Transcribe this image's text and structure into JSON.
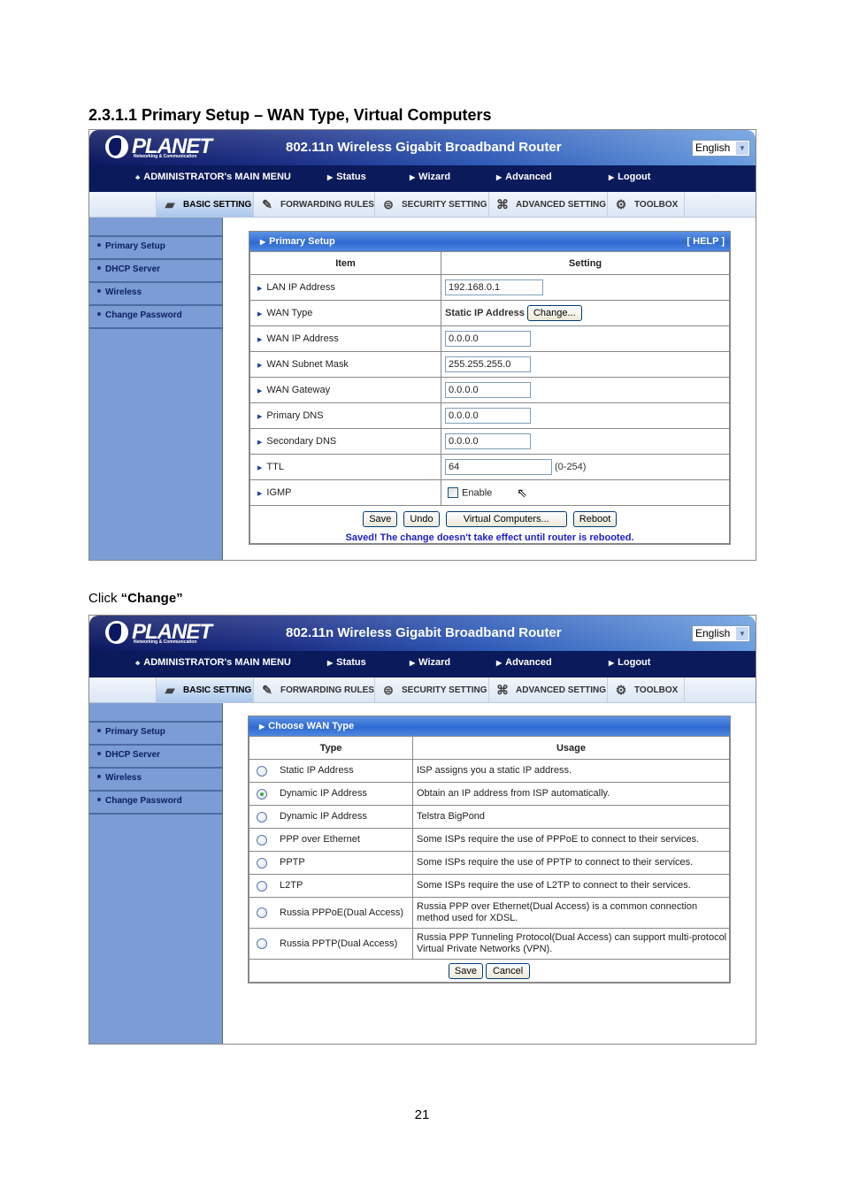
{
  "document": {
    "heading": "2.3.1.1 Primary Setup – WAN Type, Virtual Computers",
    "caption_prefix": "Click ",
    "caption_bold": "“Change”",
    "page_number": "21"
  },
  "router_ui": {
    "logo_text": "PLANET",
    "logo_subtext": "Networking & Communication",
    "product_title": "802.11n Wireless Gigabit Broadband Router",
    "language_selected": "English",
    "main_menu": {
      "admin": "ADMINISTRATOR's MAIN MENU",
      "status": "Status",
      "wizard": "Wizard",
      "advanced": "Advanced",
      "logout": "Logout"
    },
    "tabs": [
      {
        "label": "BASIC SETTING",
        "icon": "folder-icon",
        "active": true
      },
      {
        "label": "FORWARDING RULES",
        "icon": "forwarding-icon",
        "active": false
      },
      {
        "label": "SECURITY SETTING",
        "icon": "security-icon",
        "active": false
      },
      {
        "label": "ADVANCED SETTING",
        "icon": "advanced-icon",
        "active": false
      },
      {
        "label": "TOOLBOX",
        "icon": "toolbox-icon",
        "active": false
      }
    ],
    "sidebar": [
      {
        "label": "Primary Setup"
      },
      {
        "label": "DHCP Server"
      },
      {
        "label": "Wireless"
      },
      {
        "label": "Change Password"
      }
    ],
    "colors": {
      "banner_dark": "#0b1760",
      "sidebar": "#7b9cd4",
      "panel_header": "#2f6ad2",
      "saved_message": "#1d1dc8"
    }
  },
  "primary_setup": {
    "title": "Primary Setup",
    "help": "[ HELP ]",
    "col_item": "Item",
    "col_setting": "Setting",
    "rows": {
      "lan_ip": {
        "label": "LAN IP Address",
        "value": "192.168.0.1"
      },
      "wan_type": {
        "label": "WAN Type",
        "value": "Static IP Address",
        "button": "Change..."
      },
      "wan_ip": {
        "label": "WAN IP Address",
        "value": "0.0.0.0"
      },
      "wan_mask": {
        "label": "WAN Subnet Mask",
        "value": "255.255.255.0"
      },
      "wan_gw": {
        "label": "WAN Gateway",
        "value": "0.0.0.0"
      },
      "dns1": {
        "label": "Primary DNS",
        "value": "0.0.0.0"
      },
      "dns2": {
        "label": "Secondary DNS",
        "value": "0.0.0.0"
      },
      "ttl": {
        "label": "TTL",
        "value": "64",
        "range": "(0-254)"
      },
      "igmp": {
        "label": "IGMP",
        "checkbox_label": "Enable",
        "checked": false
      }
    },
    "buttons": {
      "save": "Save",
      "undo": "Undo",
      "virtual": "Virtual Computers...",
      "reboot": "Reboot"
    },
    "status_message": "Saved! The change doesn't take effect until router is rebooted."
  },
  "wan_type": {
    "title": "Choose WAN Type",
    "col_type": "Type",
    "col_usage": "Usage",
    "options": [
      {
        "type": "Static IP Address",
        "usage": "ISP assigns you a static IP address.",
        "selected": false
      },
      {
        "type": "Dynamic IP Address",
        "usage": "Obtain an IP address from ISP automatically.",
        "selected": true
      },
      {
        "type": "Dynamic IP Address",
        "usage": "Telstra BigPond",
        "selected": false
      },
      {
        "type": "PPP over Ethernet",
        "usage": "Some ISPs require the use of PPPoE to connect to their services.",
        "selected": false
      },
      {
        "type": "PPTP",
        "usage": "Some ISPs require the use of PPTP to connect to their services.",
        "selected": false
      },
      {
        "type": "L2TP",
        "usage": "Some ISPs require the use of L2TP to connect to their services.",
        "selected": false
      },
      {
        "type": "Russia PPPoE(Dual Access)",
        "usage": "Russia PPP over Ethernet(Dual Access) is a common connection method used for XDSL.",
        "selected": false
      },
      {
        "type": "Russia PPTP(Dual Access)",
        "usage": "Russia PPP Tunneling Protocol(Dual Access) can support multi-protocol Virtual Private Networks (VPN).",
        "selected": false
      }
    ],
    "buttons": {
      "save": "Save",
      "cancel": "Cancel"
    }
  }
}
